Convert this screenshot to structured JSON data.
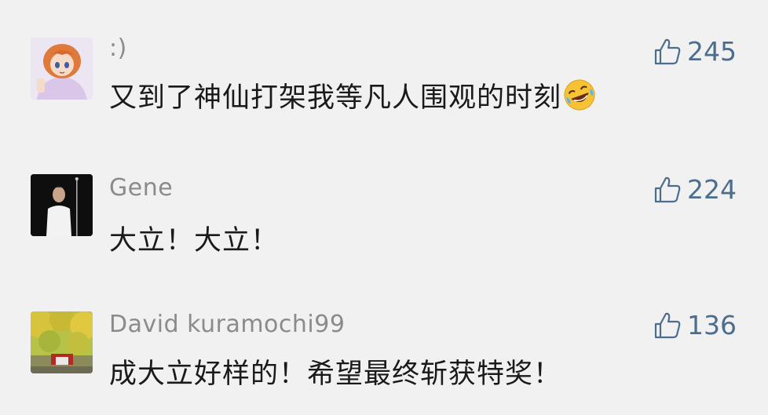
{
  "comments": [
    {
      "username": ":)",
      "text": "又到了神仙打架我等凡人围观的时刻",
      "likes": "245",
      "emoji": "rolling-on-floor-laughing-emoji"
    },
    {
      "username": "Gene",
      "text": "大立！大立！",
      "likes": "224"
    },
    {
      "username": "David kuramochi99",
      "text": "成大立好样的！希望最终斩获特奖！",
      "likes": "136"
    }
  ],
  "icons": {
    "like": "thumbs-up-icon"
  },
  "colors": {
    "background": "#f1f1f1",
    "username": "#8b8b8b",
    "text": "#1a1a1a",
    "like": "#4d6d8f"
  }
}
